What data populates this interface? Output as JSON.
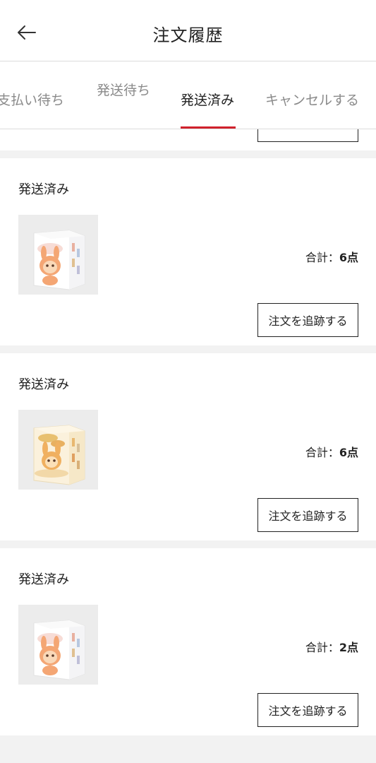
{
  "header": {
    "title": "注文履歴"
  },
  "tabs": [
    {
      "label": "支払い待ち"
    },
    {
      "label": "発送待ち"
    },
    {
      "label": "発送済み"
    },
    {
      "label": "キャンセルする"
    }
  ],
  "colors": {
    "accent": "#d0212c",
    "background": "#f2f2f2"
  },
  "orders": [
    {
      "status": "発送済み",
      "total_label": "合計：",
      "total_count": "6点",
      "track_label": "注文を追跡する",
      "product_image": "labubu-box-orange"
    },
    {
      "status": "発送済み",
      "total_label": "合計：",
      "total_count": "6点",
      "track_label": "注文を追跡する",
      "product_image": "labubu-box-yellow"
    },
    {
      "status": "発送済み",
      "total_label": "合計：",
      "total_count": "2点",
      "track_label": "注文を追跡する",
      "product_image": "labubu-box-orange"
    }
  ]
}
